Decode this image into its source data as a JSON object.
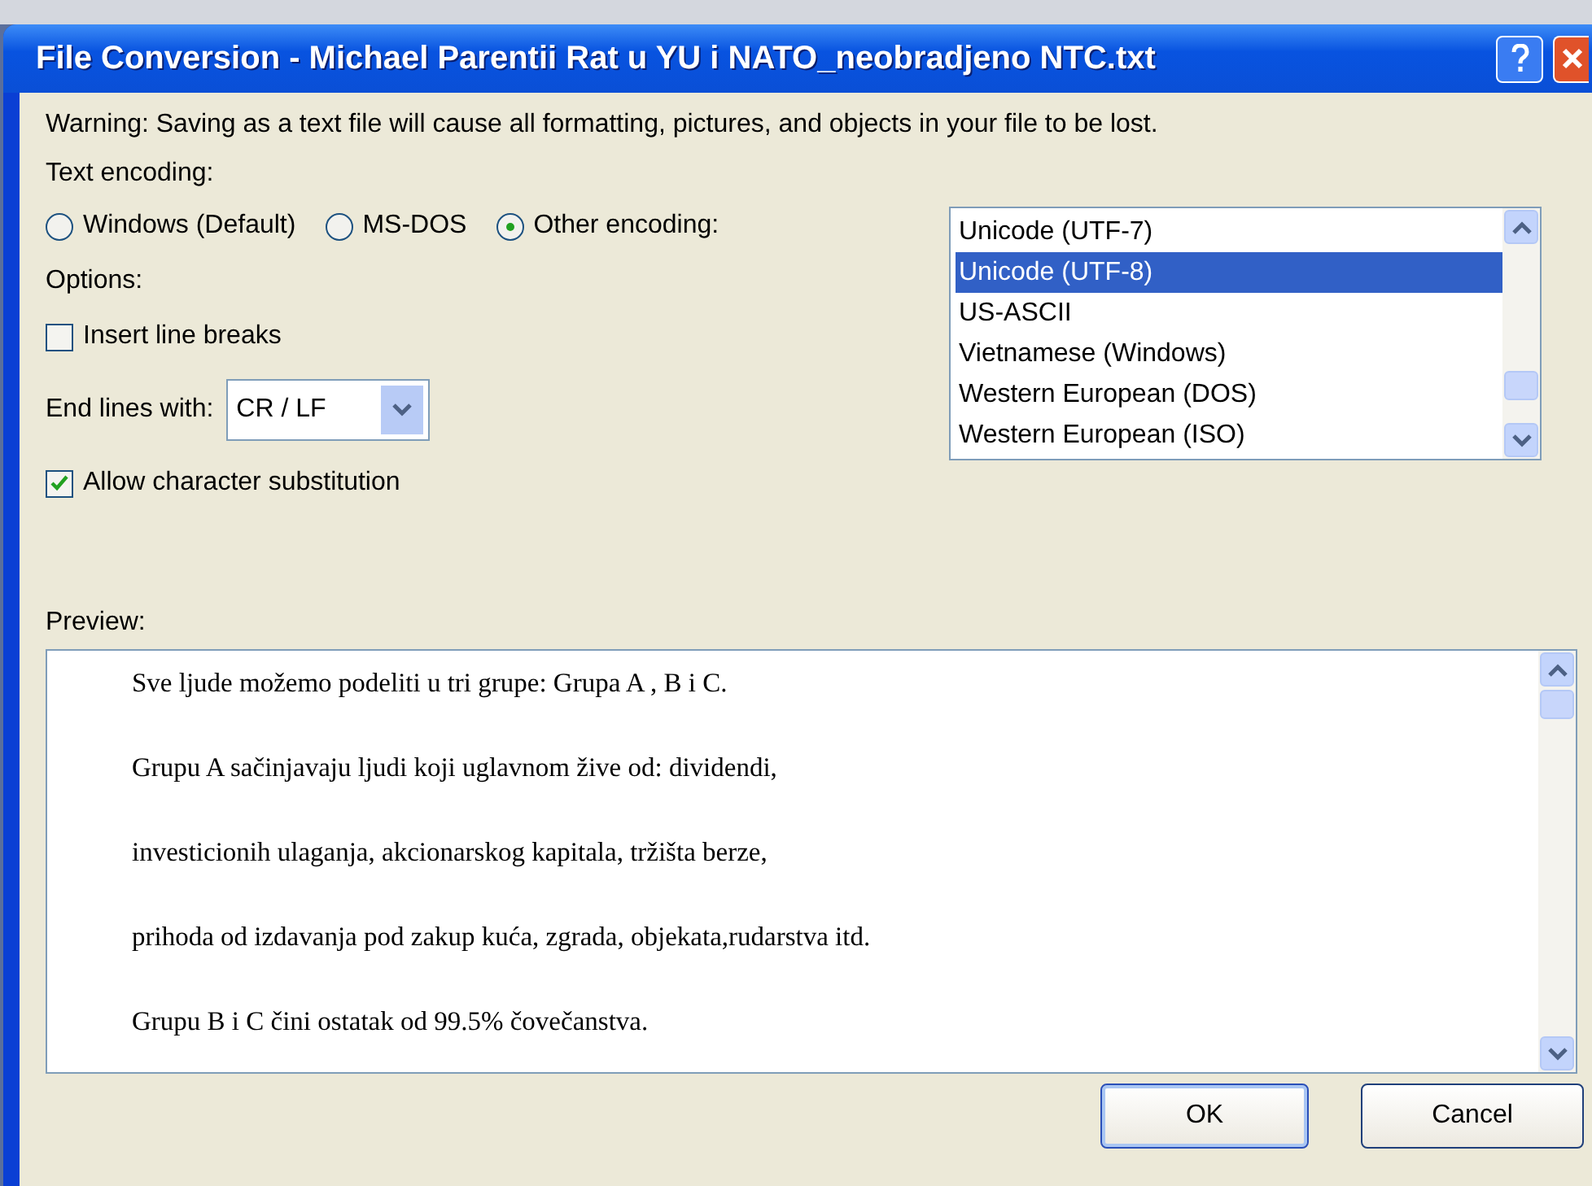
{
  "window": {
    "title": "File Conversion - Michael Parentii Rat u YU i NATO_neobradjeno NTC.txt"
  },
  "warning": "Warning: Saving as a text file will cause all formatting, pictures, and objects in your file to be lost.",
  "text_encoding": {
    "label": "Text encoding:",
    "options": [
      {
        "label": "Windows (Default)",
        "selected": false
      },
      {
        "label": "MS-DOS",
        "selected": false
      },
      {
        "label": "Other encoding:",
        "selected": true
      }
    ]
  },
  "encoding_list": {
    "items": [
      {
        "label": "Unicode (UTF-7)",
        "selected": false
      },
      {
        "label": "Unicode (UTF-8)",
        "selected": true
      },
      {
        "label": "US-ASCII",
        "selected": false
      },
      {
        "label": "Vietnamese (Windows)",
        "selected": false
      },
      {
        "label": "Western European (DOS)",
        "selected": false
      },
      {
        "label": "Western European (ISO)",
        "selected": false
      }
    ]
  },
  "options": {
    "label": "Options:",
    "insert_line_breaks": {
      "label": "Insert line breaks",
      "checked": false
    },
    "end_lines": {
      "label": "End lines with:",
      "value": "CR / LF"
    },
    "allow_substitution": {
      "label": "Allow character substitution",
      "checked": true
    }
  },
  "preview": {
    "label": "Preview:",
    "lines": [
      "Sve ljude možemo podeliti u tri grupe: Grupa A , B i C.",
      "Grupu A sačinjavaju ljudi koji uglavnom žive od: dividendi,",
      "investicionih ulaganja, akcionarskog kapitala, tržišta berze,",
      "prihoda od izdavanja pod zakup kuća, zgrada, objekata,rudarstva itd.",
      "Grupu B i C čini ostatak od 99.5% čovečanstva."
    ]
  },
  "buttons": [
    {
      "label": "OK",
      "default": true
    },
    {
      "label": "Cancel",
      "default": false
    }
  ]
}
